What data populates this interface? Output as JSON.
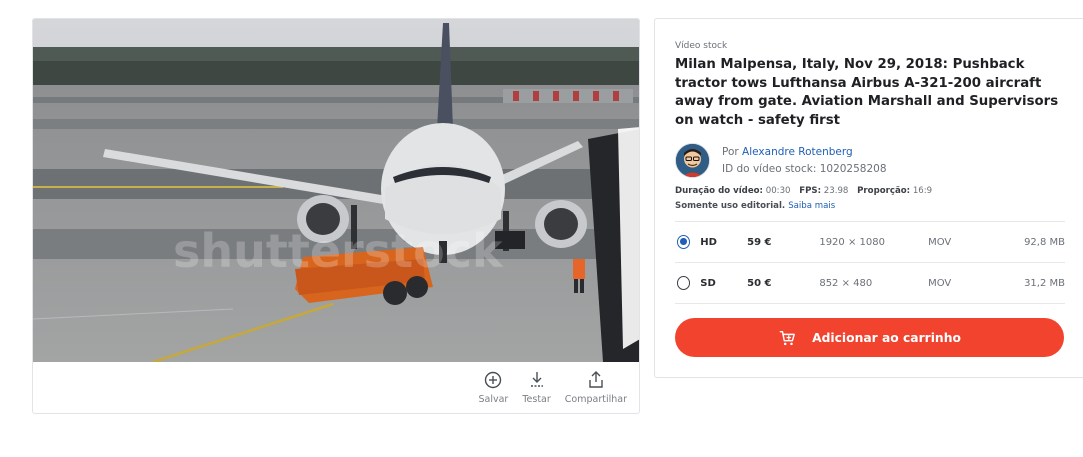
{
  "preview": {
    "watermark": "shutterstock"
  },
  "actions": [
    {
      "label": "Salvar",
      "icon": "plus-circle-icon"
    },
    {
      "label": "Testar",
      "icon": "download-icon"
    },
    {
      "label": "Compartilhar",
      "icon": "share-icon"
    }
  ],
  "details": {
    "stock_type": "Vídeo stock",
    "title": "Milan Malpensa, Italy, Nov 29, 2018: Pushback tractor tows Lufthansa Airbus A-321-200 aircraft away from gate. Aviation Marshall and Supervisors on watch - safety first",
    "author_prefix": "Por",
    "author_name": "Alexandre Rotenberg",
    "stock_id": "ID do vídeo stock: 1020258208",
    "duration_label": "Duração do vídeo:",
    "duration_value": "00:30",
    "fps_label": "FPS:",
    "fps_value": "23.98",
    "ratio_label": "Proporção:",
    "ratio_value": "16:9",
    "editorial": "Somente uso editorial.",
    "learn_more": "Saiba mais"
  },
  "options": [
    {
      "name": "HD",
      "price": "59 €",
      "dimensions": "1920 × 1080",
      "format": "MOV",
      "size": "92,8 MB",
      "selected": true
    },
    {
      "name": "SD",
      "price": "50 €",
      "dimensions": "852 × 480",
      "format": "MOV",
      "size": "31,2 MB",
      "selected": false
    }
  ],
  "cart": {
    "label": "Adicionar ao carrinho",
    "color": "#f2432f"
  }
}
